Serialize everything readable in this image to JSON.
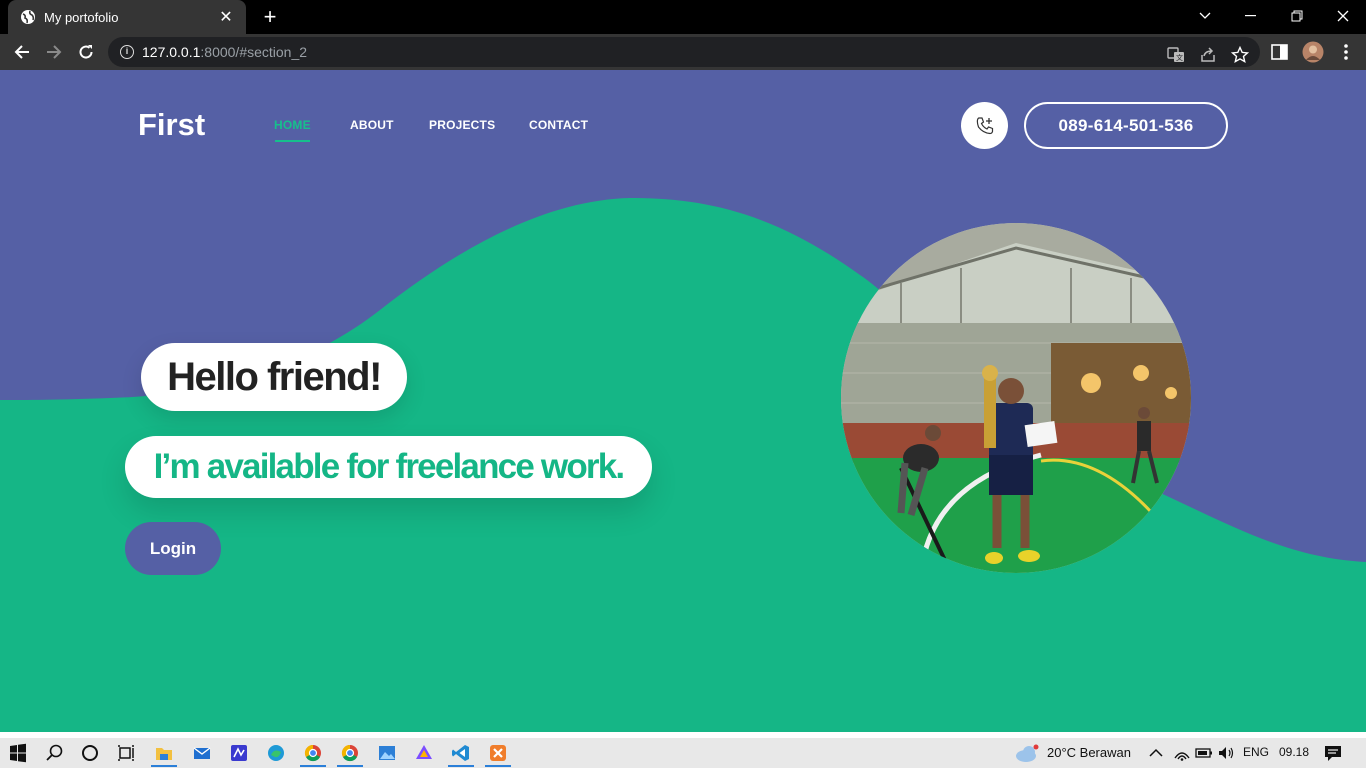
{
  "browser": {
    "tab_title": "My portofolio",
    "tab_close": "✕",
    "new_tab": "+",
    "url_host": "127.0.0.1",
    "url_path": ":8000/#section_2"
  },
  "site": {
    "brand": "First",
    "nav": [
      "HOME",
      "ABOUT",
      "PROJECTS",
      "CONTACT"
    ],
    "active_nav": "HOME",
    "phone": "089-614-501-536",
    "hero_title": "Hello friend!",
    "hero_subtitle": "I’m available for freelance work.",
    "login_label": "Login"
  },
  "colors": {
    "purple": "#5560a5",
    "green": "#15b686",
    "accent": "#16c08c"
  },
  "taskbar": {
    "weather": "20°C  Berawan",
    "lang": "ENG",
    "time": "09.18"
  }
}
